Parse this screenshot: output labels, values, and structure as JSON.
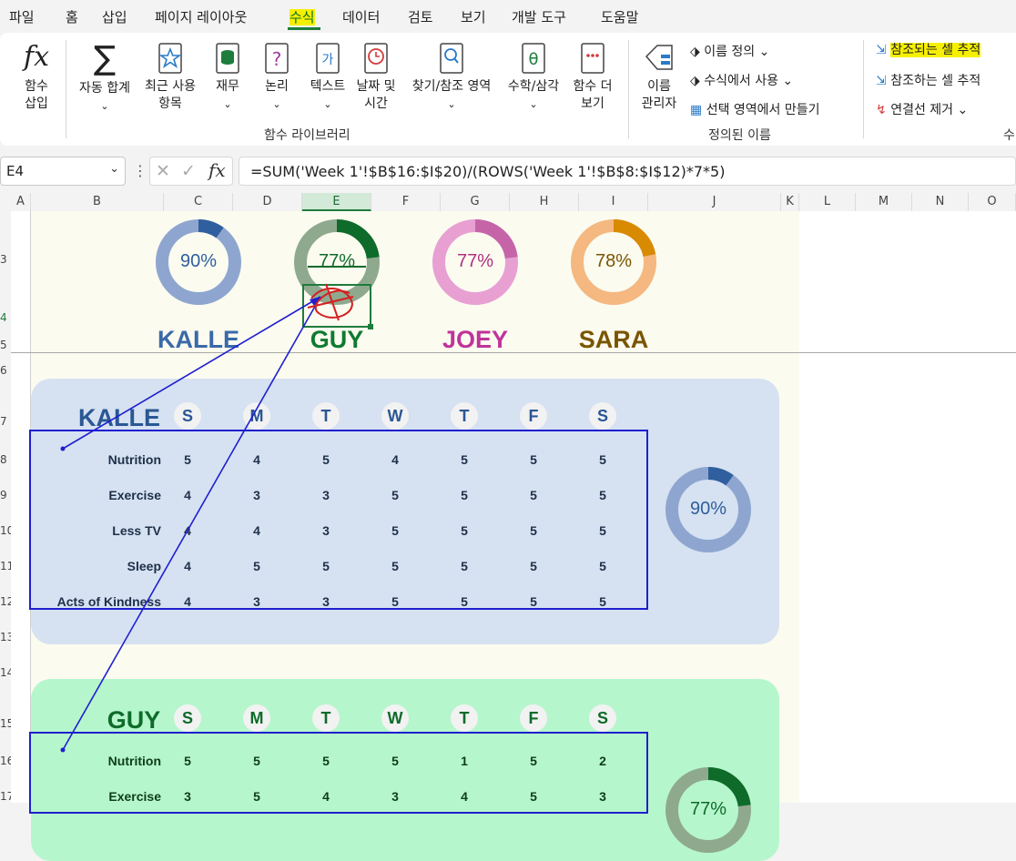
{
  "menu": {
    "items": [
      "파일",
      "홈",
      "삽입",
      "페이지 레이아웃",
      "수식",
      "데이터",
      "검토",
      "보기",
      "개발 도구",
      "도움말"
    ]
  },
  "ribbon": {
    "insert_function": [
      "함수",
      "삽입"
    ],
    "autosum": "자동 합계",
    "recent": [
      "최근 사용",
      "항목"
    ],
    "financial": "재무",
    "logical": "논리",
    "text": "텍스트",
    "datetime": [
      "날짜 및",
      "시간"
    ],
    "lookup": "찾기/참조 영역",
    "math": "수학/삼각",
    "more": [
      "함수 더",
      "보기"
    ],
    "group_library": "함수 라이브러리",
    "name_manager": [
      "이름",
      "관리자"
    ],
    "define_name": "이름 정의",
    "use_in_formula": "수식에서 사용",
    "create_from_selection": "선택 영역에서 만들기",
    "group_defined": "정의된 이름",
    "trace_precedents": "참조되는 셀 추적",
    "trace_dependents": "참조하는 셀 추적",
    "remove_arrows": "연결선 제거",
    "group_audit_cut": "수"
  },
  "formula_bar": {
    "name_box": "E4",
    "formula": "=SUM('Week 1'!$B$16:$I$20)/(ROWS('Week 1'!$B$8:$I$12)*7*5)"
  },
  "columns": [
    "A",
    "B",
    "C",
    "D",
    "E",
    "F",
    "G",
    "H",
    "I",
    "J",
    "K",
    "L",
    "M",
    "N",
    "O"
  ],
  "rows": [
    "3",
    "4",
    "5",
    "6",
    "7",
    "8",
    "9",
    "10",
    "11",
    "12",
    "13",
    "14",
    "15",
    "16",
    "17"
  ],
  "colors": {
    "kalle": "#3a6aa8",
    "guy": "#0e7a30",
    "joey": "#c0339a",
    "sara": "#7a5500",
    "trace": "#1f1fcf",
    "highlight": "#f6f000"
  },
  "summary": [
    {
      "name": "KALLE",
      "pct_label": "90%",
      "value": 0.9
    },
    {
      "name": "GUY",
      "pct_label": "77%",
      "value": 0.77
    },
    {
      "name": "JOEY",
      "pct_label": "77%",
      "value": 0.77
    },
    {
      "name": "SARA",
      "pct_label": "78%",
      "value": 0.78
    }
  ],
  "days": [
    "S",
    "M",
    "T",
    "W",
    "T",
    "F",
    "S"
  ],
  "kalle_table": {
    "title": "KALLE",
    "rows": [
      {
        "label": "Nutrition",
        "values": [
          "5",
          "4",
          "5",
          "4",
          "5",
          "5",
          "5"
        ]
      },
      {
        "label": "Exercise",
        "values": [
          "4",
          "3",
          "3",
          "5",
          "5",
          "5",
          "5"
        ]
      },
      {
        "label": "Less TV",
        "values": [
          "4",
          "4",
          "3",
          "5",
          "5",
          "5",
          "5"
        ]
      },
      {
        "label": "Sleep",
        "values": [
          "4",
          "5",
          "5",
          "5",
          "5",
          "5",
          "5"
        ]
      },
      {
        "label": "Acts of Kindness",
        "values": [
          "4",
          "3",
          "3",
          "5",
          "5",
          "5",
          "5"
        ]
      }
    ],
    "pct_label": "90%",
    "value": 0.9
  },
  "guy_table": {
    "title": "GUY",
    "rows": [
      {
        "label": "Nutrition",
        "values": [
          "5",
          "5",
          "5",
          "5",
          "1",
          "5",
          "2"
        ]
      },
      {
        "label": "Exercise",
        "values": [
          "3",
          "5",
          "4",
          "3",
          "4",
          "5",
          "3"
        ]
      }
    ],
    "pct_label": "77%",
    "value": 0.77
  }
}
